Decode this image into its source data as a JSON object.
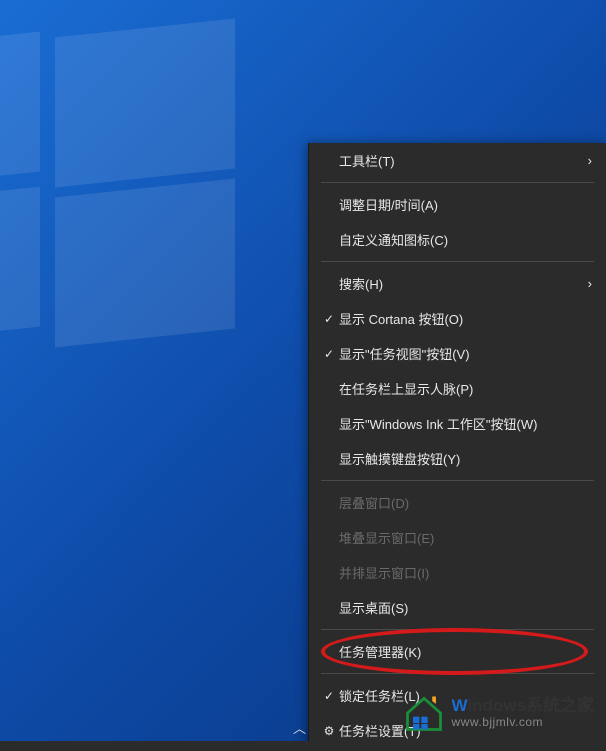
{
  "menu": {
    "items": [
      {
        "label": "工具栏(T)",
        "checked": false,
        "hasSubmenu": true,
        "disabled": false
      },
      {
        "sep": true
      },
      {
        "label": "调整日期/时间(A)",
        "checked": false,
        "hasSubmenu": false,
        "disabled": false
      },
      {
        "label": "自定义通知图标(C)",
        "checked": false,
        "hasSubmenu": false,
        "disabled": false
      },
      {
        "sep": true
      },
      {
        "label": "搜索(H)",
        "checked": false,
        "hasSubmenu": true,
        "disabled": false
      },
      {
        "label": "显示 Cortana 按钮(O)",
        "checked": true,
        "hasSubmenu": false,
        "disabled": false
      },
      {
        "label": "显示\"任务视图\"按钮(V)",
        "checked": true,
        "hasSubmenu": false,
        "disabled": false
      },
      {
        "label": "在任务栏上显示人脉(P)",
        "checked": false,
        "hasSubmenu": false,
        "disabled": false
      },
      {
        "label": "显示\"Windows Ink 工作区\"按钮(W)",
        "checked": false,
        "hasSubmenu": false,
        "disabled": false
      },
      {
        "label": "显示触摸键盘按钮(Y)",
        "checked": false,
        "hasSubmenu": false,
        "disabled": false
      },
      {
        "sep": true
      },
      {
        "label": "层叠窗口(D)",
        "checked": false,
        "hasSubmenu": false,
        "disabled": true
      },
      {
        "label": "堆叠显示窗口(E)",
        "checked": false,
        "hasSubmenu": false,
        "disabled": true
      },
      {
        "label": "并排显示窗口(I)",
        "checked": false,
        "hasSubmenu": false,
        "disabled": true
      },
      {
        "label": "显示桌面(S)",
        "checked": false,
        "hasSubmenu": false,
        "disabled": false
      },
      {
        "sep": true
      },
      {
        "label": "任务管理器(K)",
        "checked": false,
        "hasSubmenu": false,
        "disabled": false,
        "highlighted": true
      },
      {
        "sep": true
      },
      {
        "label": "锁定任务栏(L)",
        "checked": true,
        "hasSubmenu": false,
        "disabled": false
      },
      {
        "label": "任务栏设置(T)",
        "checked": false,
        "hasSubmenu": false,
        "disabled": false,
        "icon": "gear"
      }
    ]
  },
  "watermark": {
    "brand_prefix": "W",
    "brand_rest": "indows",
    "brand_suffix": "系统之家",
    "url": "www.bjjmlv.com"
  },
  "icons": {
    "check": "✓",
    "chevron_right": "›",
    "chevron_up": "︿",
    "gear": "⚙"
  }
}
